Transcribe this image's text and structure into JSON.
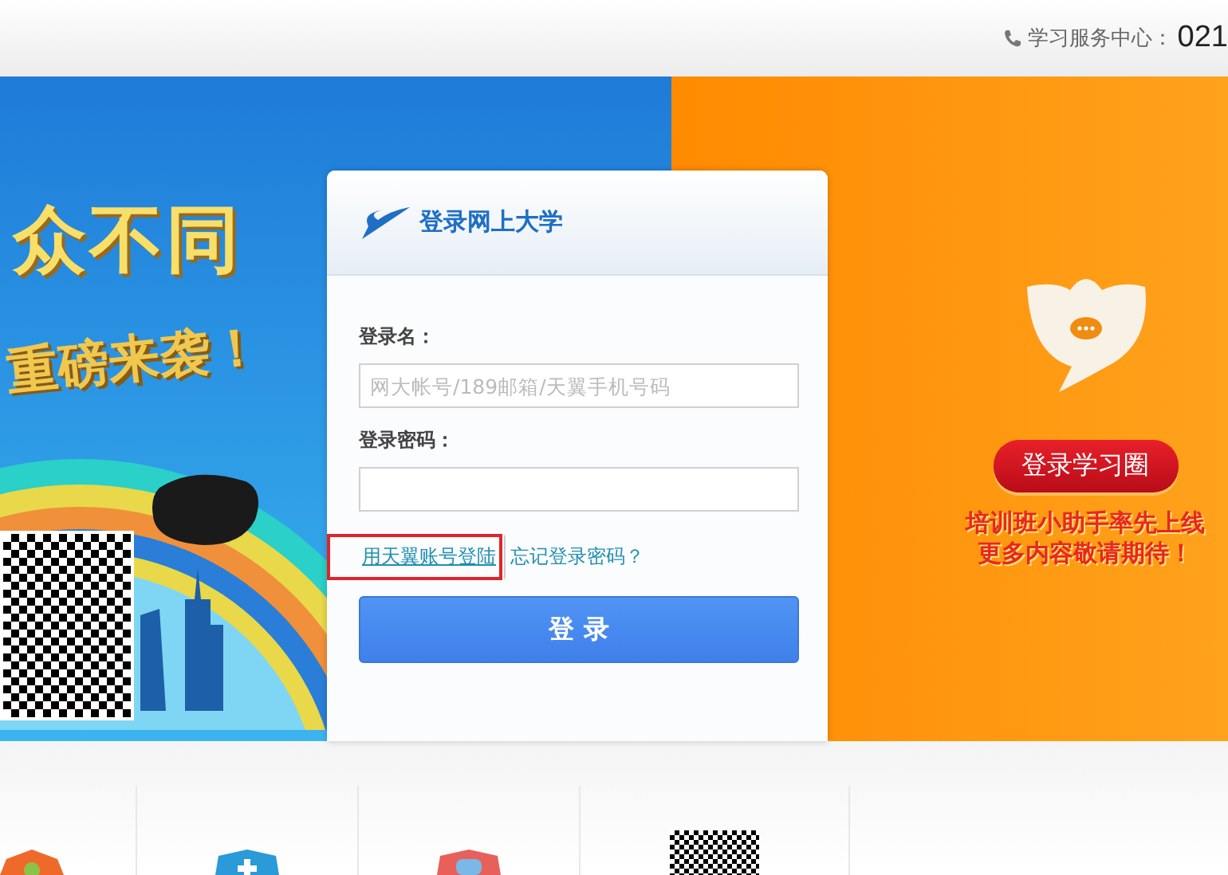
{
  "header": {
    "hotline_label": "学习服务中心：",
    "hotline_number": "021"
  },
  "banner": {
    "headline": "众不同",
    "subline": "重磅来袭！"
  },
  "login": {
    "title": "登录网上大学",
    "username_label": "登录名：",
    "username_placeholder": "网大帐号/189邮箱/天翼手机号码",
    "password_label": "登录密码：",
    "links": [
      {
        "text": "用天翼账号登陆",
        "highlighted": true
      },
      {
        "text": "忘记登录密码？",
        "highlighted": false
      }
    ],
    "submit": "登 录"
  },
  "promo": {
    "button": "登录学习圈",
    "lines": [
      "培训班小助手率先上线",
      "更多内容敬请期待！"
    ]
  }
}
